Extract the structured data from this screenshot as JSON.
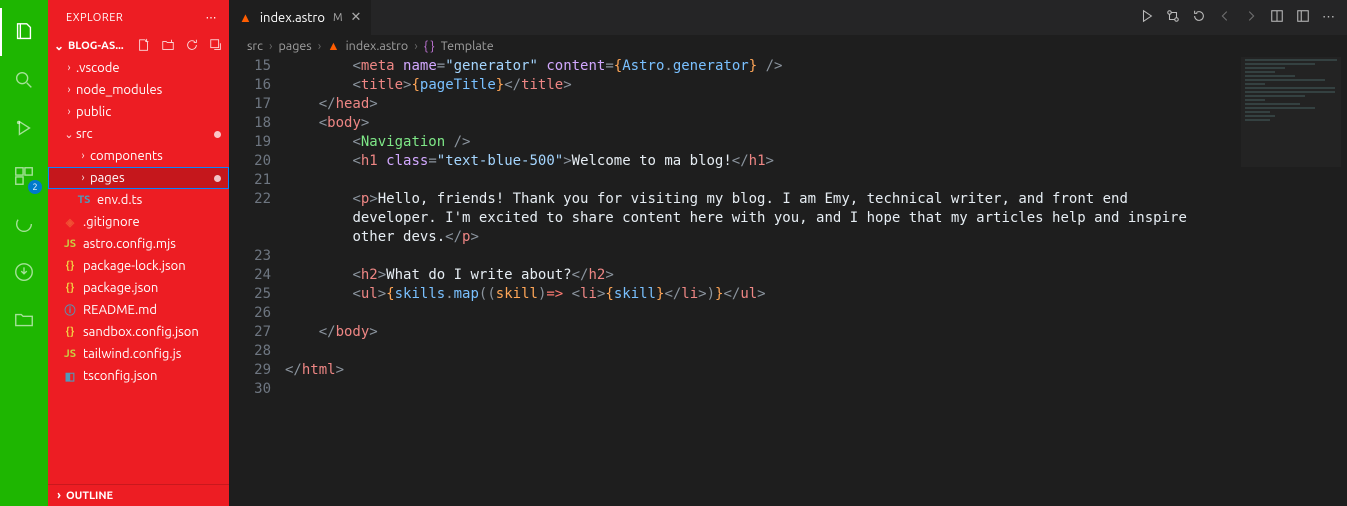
{
  "sidebar": {
    "title": "EXPLORER",
    "workspace": "BLOG-AS...",
    "outline_label": "OUTLINE",
    "tree": {
      "vscode": ".vscode",
      "node_modules": "node_modules",
      "public": "public",
      "src": "src",
      "components": "components",
      "pages": "pages",
      "envdts": "env.d.ts",
      "gitignore": ".gitignore",
      "astrocfg": "astro.config.mjs",
      "pkglock": "package-lock.json",
      "pkg": "package.json",
      "readme": "README.md",
      "sandbox": "sandbox.config.json",
      "tailwind": "tailwind.config.js",
      "tsconfig": "tsconfig.json"
    }
  },
  "activity": {
    "badge": "2"
  },
  "tab": {
    "file": "index.astro",
    "modified_marker": "M"
  },
  "breadcrumbs": {
    "seg1": "src",
    "seg2": "pages",
    "seg3": "index.astro",
    "seg4": "Template"
  },
  "editor": {
    "line_numbers": [
      "15",
      "16",
      "17",
      "18",
      "19",
      "20",
      "21",
      "22",
      "",
      "23",
      "24",
      "25",
      "26",
      "27",
      "28",
      "29",
      "30"
    ],
    "code": {
      "l15_meta_name": "name",
      "l15_gen": "\"generator\"",
      "l15_content": "content",
      "l15_astro": "Astro",
      "l15_g": "generator",
      "l16_title": "title",
      "l16_pt": "pageTitle",
      "l17_head": "head",
      "l18_body": "body",
      "l19_nav": "Navigation",
      "l20_h1": "h1",
      "l20_class": "class",
      "l20_val": "\"text-blue-500\"",
      "l20_txt": "Welcome to ma blog!",
      "l22_p": "p",
      "l22_txt1": "Hello, friends! Thank you for visiting my blog. I am Emy, technical writer, and front end ",
      "l22_txt2": "developer. I'm excited to share content here with you, and I hope that my articles help and inspire ",
      "l22_txt3": "other devs.",
      "l24_h2": "h2",
      "l24_txt": "What do I write about?",
      "l25_ul": "ul",
      "l25_sk": "skills",
      "l25_map": "map",
      "l25_skv": "skill",
      "l25_li": "li",
      "l27_body": "body",
      "l29_html": "html"
    }
  }
}
